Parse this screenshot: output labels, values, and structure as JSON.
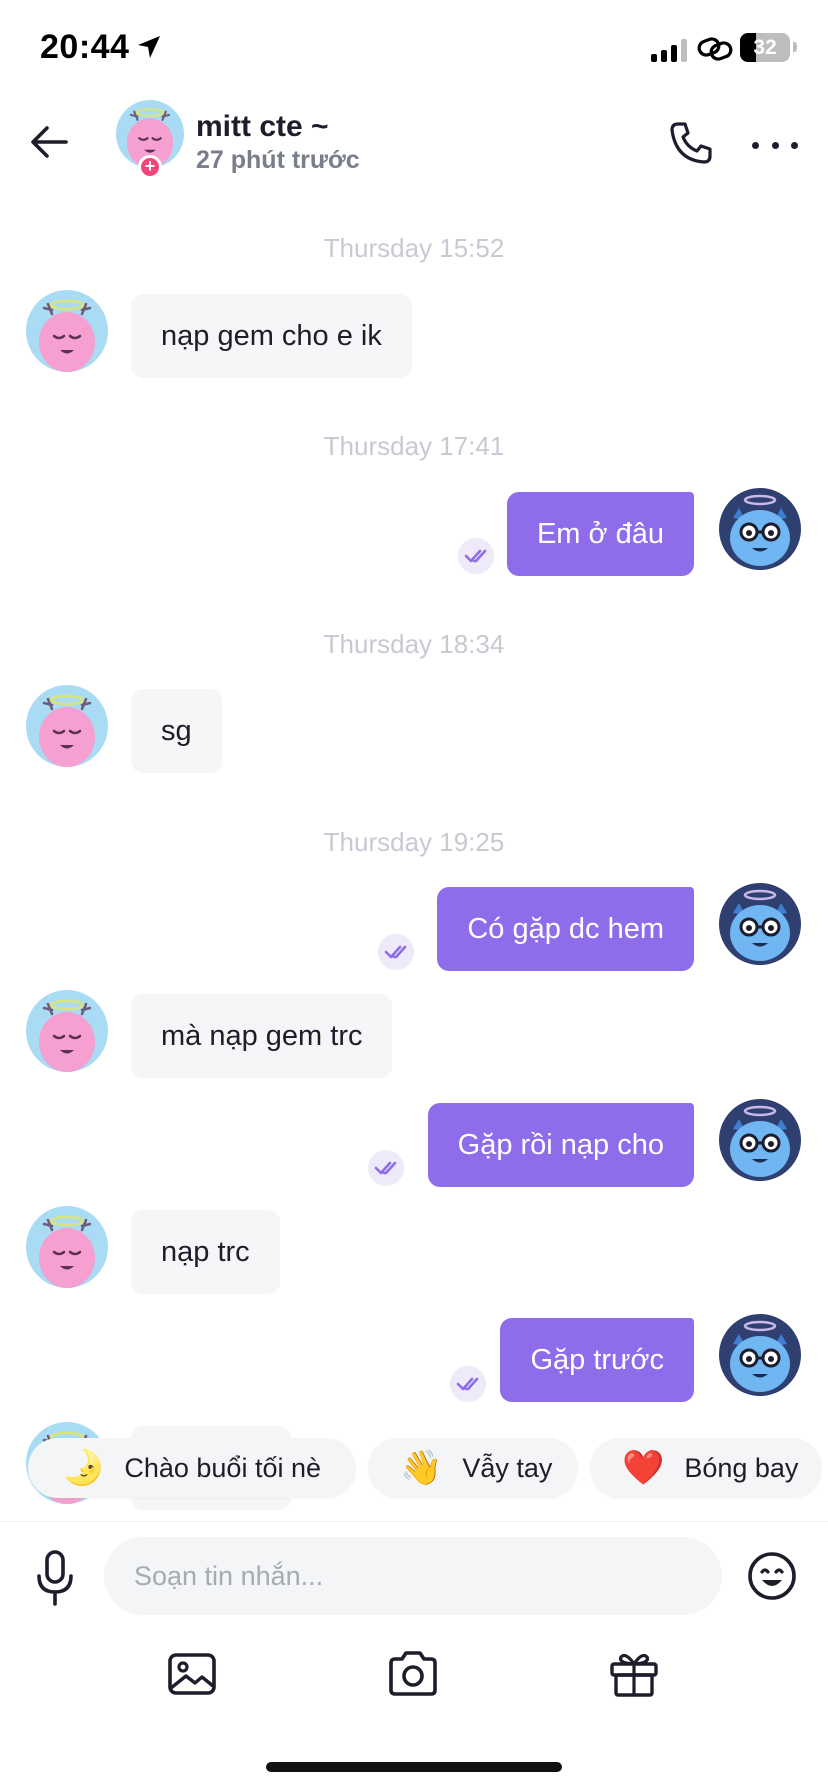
{
  "status_bar": {
    "time": "20:44",
    "battery": "32",
    "battery_level": 0.32
  },
  "header": {
    "name": "mitt cte ~",
    "last_seen": "27 phút trước"
  },
  "messages": {
    "ts1": "Thursday 15:52",
    "m1": "nạp gem cho e ik",
    "ts2": "Thursday 17:41",
    "m2": "Em ở đâu",
    "ts3": "Thursday 18:34",
    "m3": "sg",
    "ts4": "Thursday 19:25",
    "m4": "Có gặp dc hem",
    "m5": "mà nạp gem trc",
    "m6": "Gặp rồi nạp cho",
    "m7": "nạp trc",
    "m8": "Gặp trước"
  },
  "quick_replies": [
    {
      "emoji": "🌛",
      "label": "Chào buổi tối nè"
    },
    {
      "emoji": "👋",
      "label": "Vẫy tay"
    },
    {
      "emoji": "❤️",
      "label": "Bóng bay"
    }
  ],
  "composer": {
    "placeholder": "Soạn tin nhắn..."
  },
  "colors": {
    "accent": "#8e6cea",
    "incoming_bubble": "#f6f6f8",
    "badge": "#f0467c"
  },
  "icons": [
    "back-arrow-icon",
    "phone-icon",
    "more-icon",
    "mic-icon",
    "emoji-icon",
    "image-icon",
    "camera-icon",
    "gift-icon",
    "double-check-icon"
  ]
}
